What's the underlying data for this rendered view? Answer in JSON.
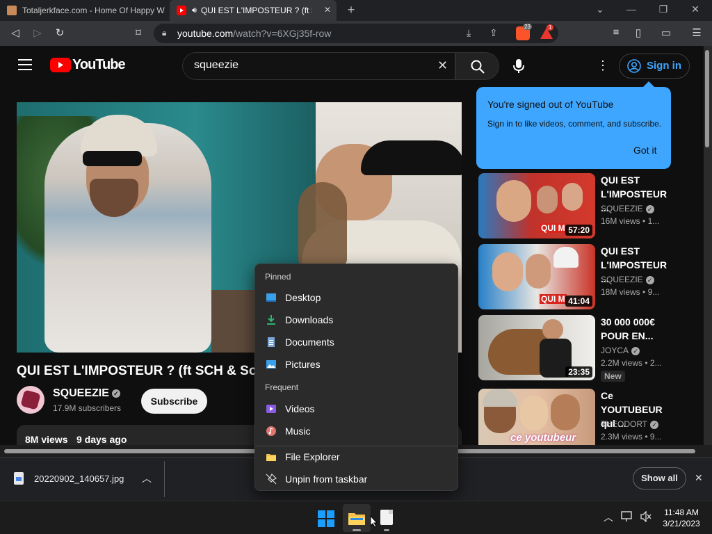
{
  "browser": {
    "tabs": [
      {
        "title": "Totaljerkface.com - Home Of Happy W",
        "active": false
      },
      {
        "title": "QUI EST L'IMPOSTEUR ? (ft SC",
        "active": true
      }
    ],
    "new_tab_symbol": "+",
    "url_host": "youtube.com",
    "url_path": "/watch?v=6XGj35f-row",
    "brave_badge": "23",
    "alert_badge": "1"
  },
  "youtube": {
    "logo_text": "YouTube",
    "search_value": "squeezie",
    "signin_label": "Sign in",
    "tooltip": {
      "title": "You're signed out of YouTube",
      "body": "Sign in to like videos, comment, and subscribe.",
      "action": "Got it"
    },
    "video": {
      "title": "QUI EST L'IMPOSTEUR ? (ft SCH & Soso",
      "channel": "SQUEEZIE",
      "subscribers": "17.9M subscribers",
      "subscribe_label": "Subscribe",
      "views": "8M views",
      "age": "9 days ago"
    },
    "sidebar": [
      {
        "title": "QUI EST L'IMPOSTEUR ...",
        "channel": "SQUEEZIE",
        "views": "16M views",
        "age": "1...",
        "duration": "57:20",
        "overlay": "QUI M",
        "badge": ""
      },
      {
        "title": "QUI EST L'IMPOSTEUR ...",
        "channel": "SQUEEZIE",
        "views": "18M views",
        "age": "9...",
        "duration": "41:04",
        "overlay": "QUI M",
        "badge": ""
      },
      {
        "title": "30 000 000€ POUR EN...",
        "channel": "JOYCA",
        "views": "2.2M views",
        "age": "2...",
        "duration": "23:35",
        "overlay": "",
        "badge": "New"
      },
      {
        "title": "Ce YOUTUBEUR qui ...",
        "channel": "THEODORT",
        "views": "2.3M views",
        "age": "9...",
        "duration": "",
        "overlay": "ce youtubeur",
        "badge": ""
      }
    ]
  },
  "download": {
    "filename": "20220902_140657.jpg",
    "show_all": "Show all"
  },
  "jumplist": {
    "pinned_header": "Pinned",
    "pinned": [
      "Desktop",
      "Downloads",
      "Documents",
      "Pictures"
    ],
    "frequent_header": "Frequent",
    "frequent": [
      "Videos",
      "Music"
    ],
    "actions": [
      "File Explorer",
      "Unpin from taskbar"
    ]
  },
  "taskbar": {
    "time": "11:48 AM",
    "date": "3/21/2023"
  },
  "colors": {
    "yt_red": "#ff0000",
    "yt_blue": "#3ea6ff",
    "win_blue": "#1a9fff"
  }
}
